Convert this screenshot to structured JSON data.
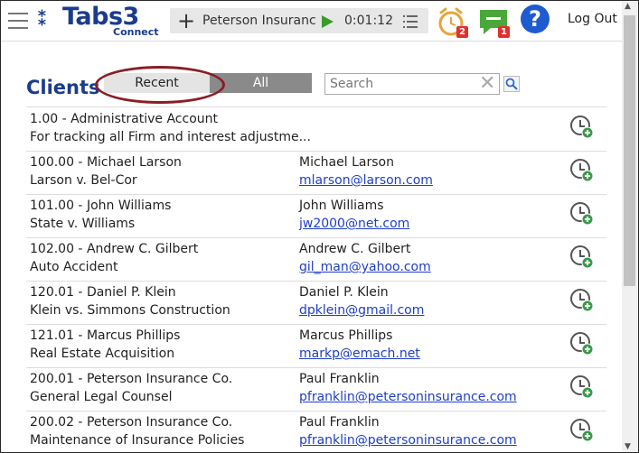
{
  "header": {
    "brand": "Tabs3",
    "brand_sub": "Connect",
    "timer_client": "Peterson Insuranc",
    "timer_time": "0:01:12",
    "alarm_badge": "2",
    "chat_badge": "1",
    "help_label": "?",
    "logout_label": "Log Out",
    "icons": [
      "hamburger-icon",
      "tabs3-logo",
      "plus-icon",
      "play-icon",
      "list-icon",
      "alarm-clock-icon",
      "chat-icon",
      "help-icon"
    ]
  },
  "clients": {
    "title": "Clients",
    "tabs": [
      {
        "label": "Recent",
        "selected": true
      },
      {
        "label": "All",
        "selected": false
      }
    ],
    "search_placeholder": "Search",
    "accent_color": "#1a3c8c",
    "link_color": "#1e3ec8",
    "rows": [
      {
        "line1": "1.00 - Administrative Account",
        "line2": "For tracking all Firm and interest adjustme...",
        "contact": "",
        "email": ""
      },
      {
        "line1": "100.00 - Michael Larson",
        "line2": "Larson v. Bel-Cor",
        "contact": "Michael Larson",
        "email": "mlarson@larson.com"
      },
      {
        "line1": "101.00 - John Williams",
        "line2": "State v. Williams",
        "contact": "John Williams",
        "email": "jw2000@net.com"
      },
      {
        "line1": "102.00 - Andrew C. Gilbert",
        "line2": "Auto Accident",
        "contact": "Andrew C. Gilbert",
        "email": "gil_man@yahoo.com"
      },
      {
        "line1": "120.01 - Daniel P. Klein",
        "line2": "Klein vs. Simmons Construction",
        "contact": "Daniel P. Klein",
        "email": "dpklein@gmail.com"
      },
      {
        "line1": "121.01 - Marcus Phillips",
        "line2": "Real Estate Acquisition",
        "contact": "Marcus Phillips",
        "email": "markp@emach.net"
      },
      {
        "line1": "200.01 - Peterson Insurance Co.",
        "line2": "General Legal Counsel",
        "contact": "Paul Franklin",
        "email": "pfranklin@petersoninsurance.com"
      },
      {
        "line1": "200.02 - Peterson Insurance Co.",
        "line2": "Maintenance of Insurance Policies",
        "contact": "Paul Franklin",
        "email": "pfranklin@petersoninsurance.com"
      }
    ]
  }
}
